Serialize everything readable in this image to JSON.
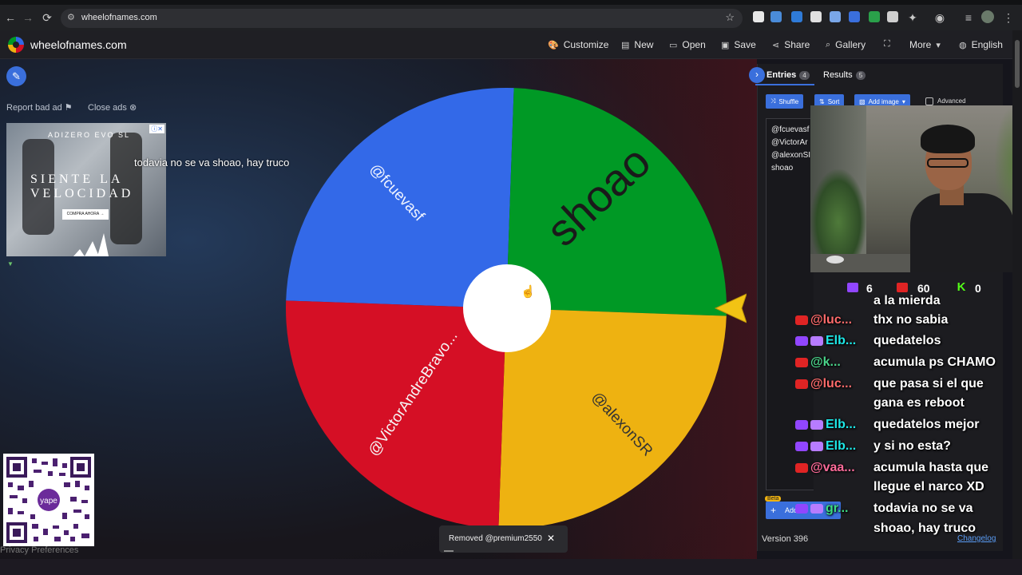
{
  "browser": {
    "url": "wheelofnames.com"
  },
  "appbar": {
    "site_name": "wheelofnames.com",
    "nav": [
      "Customize",
      "New",
      "Open",
      "Save",
      "Share",
      "Gallery",
      "More",
      "English"
    ]
  },
  "ads": {
    "report_label": "Report bad ad",
    "close_label": "Close ads",
    "ad_line1": "ADIZERO EVO SL",
    "ad_line2": "SIENTE LA",
    "ad_line3": "VELOCIDAD",
    "ad_cta": "COMPRA AHORA →",
    "ad_tag": "ⓘ✕"
  },
  "overlay_message": "todavia no se va shoao, hay truco",
  "wheel": {
    "segments": [
      {
        "label": "@fcuevasf",
        "color": "#3369e8"
      },
      {
        "label": "shoao",
        "color": "#009925"
      },
      {
        "label": "@alexonSR",
        "color": "#eeb211"
      },
      {
        "label": "@VictorAndreBravo...",
        "color": "#d50f25"
      }
    ]
  },
  "toast": {
    "text": "Removed @premium2550",
    "close": "✕"
  },
  "privacy": "Privacy Preferences",
  "panel": {
    "tab_entries": "Entries",
    "entries_count": "4",
    "tab_results": "Results",
    "results_count": "5",
    "shuffle": "Shuffle",
    "sort": "Sort",
    "add_image": "Add image",
    "advanced": "Advanced",
    "entries": [
      "@fcuevasf",
      "@VictorAr",
      "@alexonSI",
      "shoao"
    ],
    "beta": "Beta",
    "add_label": "Add",
    "version": "Version 396",
    "changelog": "Changelog"
  },
  "stream": {
    "twitch_count": "6",
    "youtube_count": "60",
    "kick_count": "0",
    "kick_letter": "K",
    "partial_line": "a la mierda",
    "chat": [
      {
        "platform": "yt",
        "user": "@luc...",
        "color": "u-red",
        "msg": "thx no sabia"
      },
      {
        "platform": "tw",
        "user": "Elb...",
        "color": "u-cyan",
        "msg": "quedatelos"
      },
      {
        "platform": "yt",
        "user": "@k...",
        "color": "u-green",
        "msg": "acumula ps CHAMO"
      },
      {
        "platform": "yt",
        "user": "@luc...",
        "color": "u-red",
        "msg": "que pasa si el que"
      },
      {
        "platform": "none",
        "user": "",
        "color": "",
        "msg": "gana es reboot"
      },
      {
        "platform": "tw",
        "user": "Elb...",
        "color": "u-cyan",
        "msg": "quedatelos mejor"
      },
      {
        "platform": "tw",
        "user": "Elb...",
        "color": "u-cyan",
        "msg": "y si no esta?"
      },
      {
        "platform": "yt",
        "user": "@vaa...",
        "color": "u-pink",
        "msg": "acumula hasta que"
      },
      {
        "platform": "none",
        "user": "",
        "color": "",
        "msg": "llegue el narco XD"
      },
      {
        "platform": "tw",
        "user": "gr...",
        "color": "u-lime",
        "msg": "todavia no se va"
      },
      {
        "platform": "none",
        "user": "",
        "color": "",
        "msg": "shoao, hay truco"
      }
    ]
  }
}
